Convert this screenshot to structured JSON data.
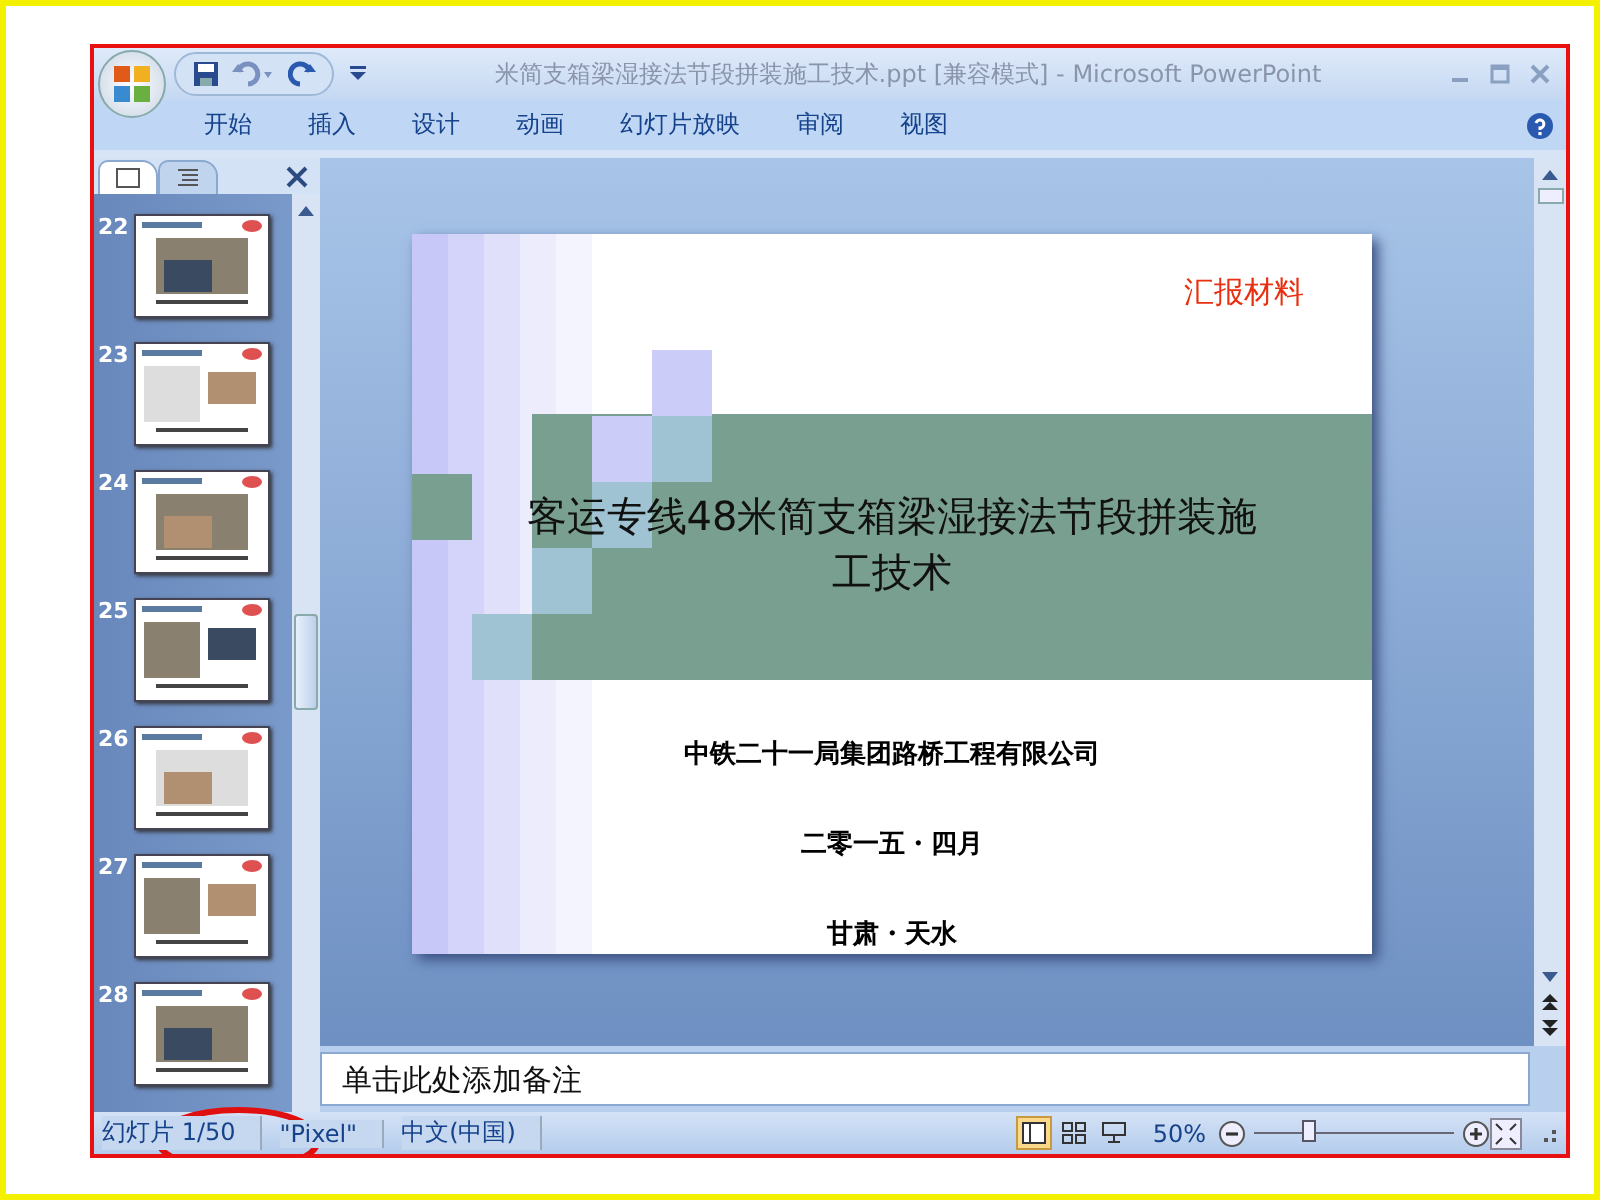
{
  "window": {
    "title": "米简支箱梁湿接法节段拼装施工技术.ppt [兼容模式] - Microsoft PowerPoint"
  },
  "ribbon_tabs": [
    {
      "label": "开始"
    },
    {
      "label": "插入"
    },
    {
      "label": "设计"
    },
    {
      "label": "动画"
    },
    {
      "label": "幻灯片放映"
    },
    {
      "label": "审阅"
    },
    {
      "label": "视图"
    }
  ],
  "slide_panel": {
    "tabs": [
      {
        "kind": "slides",
        "selected": true
      },
      {
        "kind": "outline",
        "selected": false
      }
    ],
    "thumbnails": [
      {
        "number": "22",
        "kind": "picture"
      },
      {
        "number": "23",
        "kind": "picture"
      },
      {
        "number": "24",
        "kind": "picture"
      },
      {
        "number": "25",
        "kind": "picture"
      },
      {
        "number": "26",
        "kind": "picture"
      },
      {
        "number": "27",
        "kind": "picture"
      },
      {
        "number": "28",
        "kind": "picture"
      }
    ]
  },
  "slide": {
    "tag": "汇报材料",
    "title": "客运专线48米简支箱梁湿接法节段拼装施工技术",
    "company": "中铁二十一局集团路桥工程有限公司",
    "date": "二零一五・四月",
    "place": "甘肃・天水"
  },
  "notes": {
    "placeholder": "单击此处添加备注"
  },
  "status_bar": {
    "slide_counter": "幻灯片 1/50",
    "theme": "\"Pixel\"",
    "language": "中文(中国)",
    "views": [
      {
        "kind": "normal",
        "selected": true
      },
      {
        "kind": "sorter",
        "selected": false
      },
      {
        "kind": "show",
        "selected": false
      }
    ],
    "zoom": "50%",
    "zoom_slider": {
      "level": 0.27
    }
  }
}
